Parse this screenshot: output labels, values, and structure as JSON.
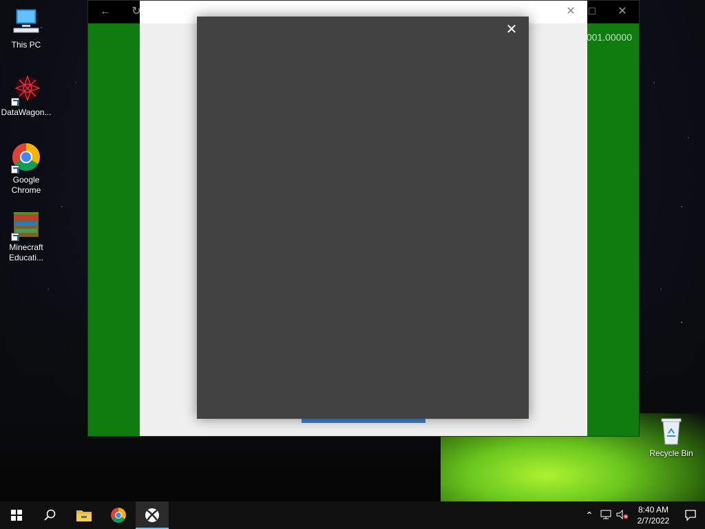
{
  "desktop": {
    "icons": [
      {
        "label": "This PC"
      },
      {
        "label": "DataWagon..."
      },
      {
        "label": "Google Chrome"
      },
      {
        "label": "Minecraft Educati..."
      }
    ],
    "recycle_bin": {
      "label": "Recycle Bin"
    }
  },
  "app_window": {
    "value_text": "001.00000",
    "accent_color": "#107c10"
  },
  "dialog_host": {
    "close_icon": "close-icon"
  },
  "modal": {
    "close_icon": "close-icon",
    "background_color": "#424242"
  },
  "taskbar": {
    "start_icon": "windows-start-icon",
    "search_icon": "search-icon",
    "pinned": [
      "file-explorer-icon",
      "chrome-icon",
      "xbox-icon"
    ],
    "active_app": "xbox-icon",
    "clock": {
      "time": "8:40 AM",
      "date": "2/7/2022"
    }
  }
}
